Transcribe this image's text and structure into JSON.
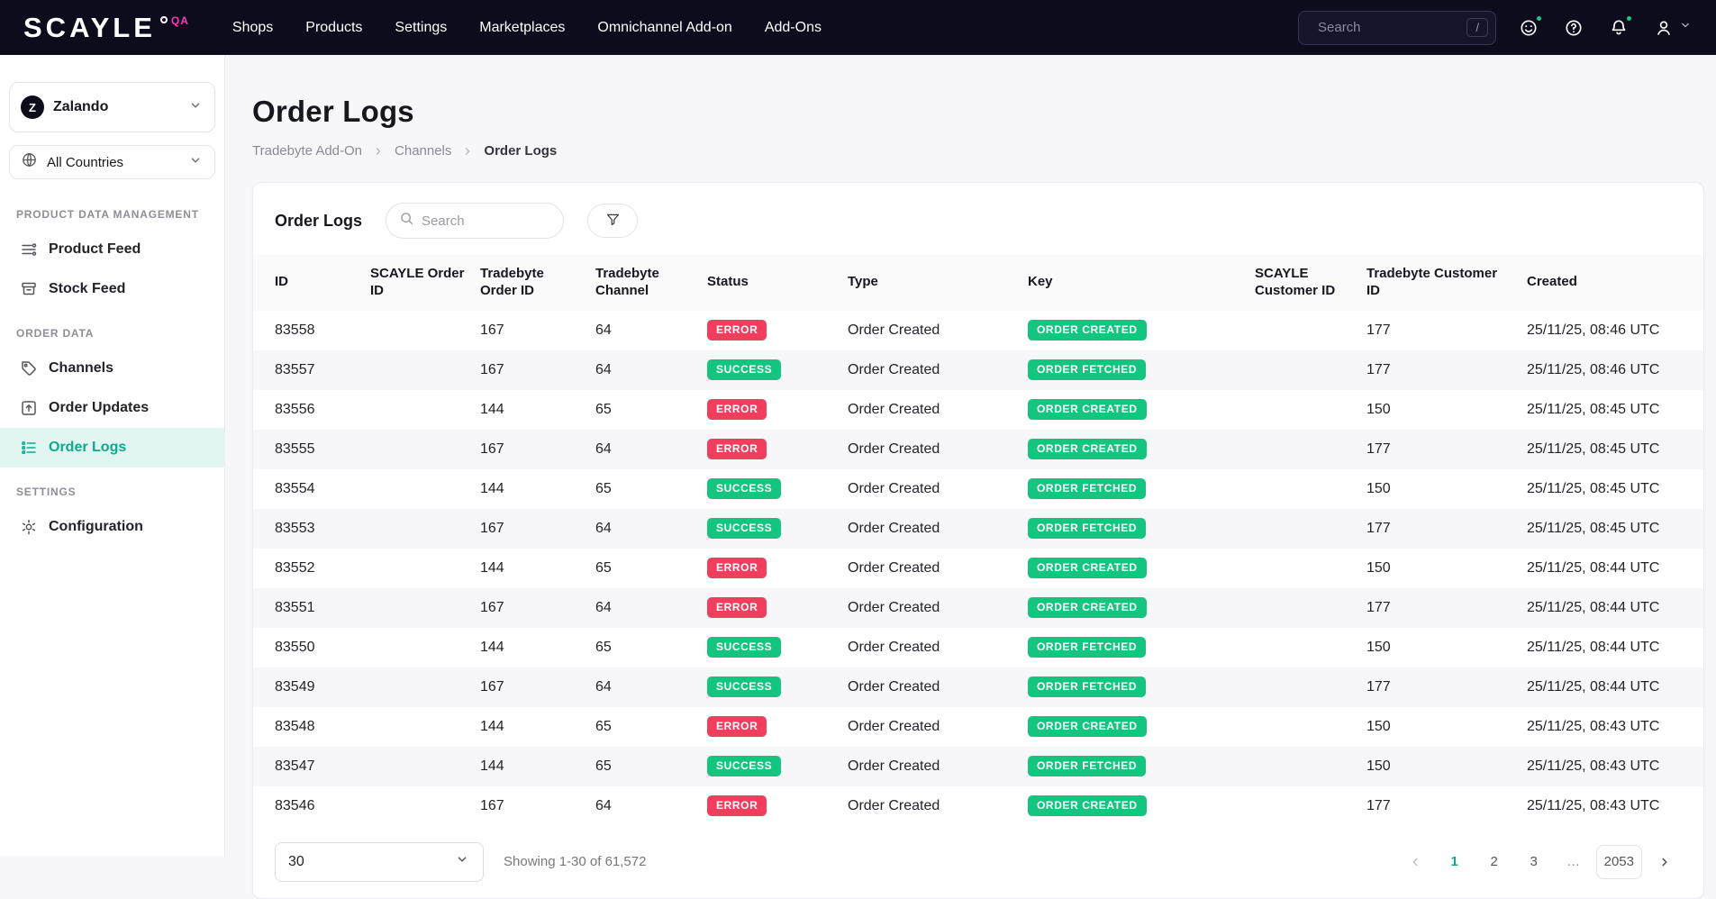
{
  "topbar": {
    "logo": "SCAYLE",
    "env": "QA",
    "nav": [
      "Shops",
      "Products",
      "Settings",
      "Marketplaces",
      "Omnichannel Add-on",
      "Add-Ons"
    ],
    "search": {
      "placeholder": "Search",
      "shortcut": "/"
    }
  },
  "sidebar": {
    "shop_selector": {
      "initial": "Z",
      "name": "Zalando"
    },
    "country_selector": {
      "label": "All Countries"
    },
    "sections": [
      {
        "title": "PRODUCT DATA MANAGEMENT",
        "items": [
          {
            "label": "Product Feed",
            "icon": "product-feed-icon",
            "active": false
          },
          {
            "label": "Stock Feed",
            "icon": "stock-feed-icon",
            "active": false
          }
        ]
      },
      {
        "title": "ORDER DATA",
        "items": [
          {
            "label": "Channels",
            "icon": "channels-icon",
            "active": false
          },
          {
            "label": "Order Updates",
            "icon": "order-updates-icon",
            "active": false
          },
          {
            "label": "Order Logs",
            "icon": "order-logs-icon",
            "active": true
          }
        ]
      },
      {
        "title": "SETTINGS",
        "items": [
          {
            "label": "Configuration",
            "icon": "configuration-icon",
            "active": false
          }
        ]
      }
    ]
  },
  "page": {
    "title": "Order Logs",
    "breadcrumb": [
      "Tradebyte Add-On",
      "Channels",
      "Order Logs"
    ]
  },
  "card": {
    "title": "Order Logs",
    "search_placeholder": "Search",
    "columns": [
      "ID",
      "SCAYLE Order ID",
      "Tradebyte Order ID",
      "Tradebyte Channel",
      "Status",
      "Type",
      "Key",
      "SCAYLE Customer ID",
      "Tradebyte Customer ID",
      "Created"
    ],
    "rows": [
      [
        "83558",
        "",
        "167",
        "64",
        "ERROR",
        "Order Created",
        "ORDER CREATED",
        "",
        "177",
        "25/11/25, 08:46 UTC"
      ],
      [
        "83557",
        "",
        "167",
        "64",
        "SUCCESS",
        "Order Created",
        "ORDER FETCHED",
        "",
        "177",
        "25/11/25, 08:46 UTC"
      ],
      [
        "83556",
        "",
        "144",
        "65",
        "ERROR",
        "Order Created",
        "ORDER CREATED",
        "",
        "150",
        "25/11/25, 08:45 UTC"
      ],
      [
        "83555",
        "",
        "167",
        "64",
        "ERROR",
        "Order Created",
        "ORDER CREATED",
        "",
        "177",
        "25/11/25, 08:45 UTC"
      ],
      [
        "83554",
        "",
        "144",
        "65",
        "SUCCESS",
        "Order Created",
        "ORDER FETCHED",
        "",
        "150",
        "25/11/25, 08:45 UTC"
      ],
      [
        "83553",
        "",
        "167",
        "64",
        "SUCCESS",
        "Order Created",
        "ORDER FETCHED",
        "",
        "177",
        "25/11/25, 08:45 UTC"
      ],
      [
        "83552",
        "",
        "144",
        "65",
        "ERROR",
        "Order Created",
        "ORDER CREATED",
        "",
        "150",
        "25/11/25, 08:44 UTC"
      ],
      [
        "83551",
        "",
        "167",
        "64",
        "ERROR",
        "Order Created",
        "ORDER CREATED",
        "",
        "177",
        "25/11/25, 08:44 UTC"
      ],
      [
        "83550",
        "",
        "144",
        "65",
        "SUCCESS",
        "Order Created",
        "ORDER FETCHED",
        "",
        "150",
        "25/11/25, 08:44 UTC"
      ],
      [
        "83549",
        "",
        "167",
        "64",
        "SUCCESS",
        "Order Created",
        "ORDER FETCHED",
        "",
        "177",
        "25/11/25, 08:44 UTC"
      ],
      [
        "83548",
        "",
        "144",
        "65",
        "ERROR",
        "Order Created",
        "ORDER CREATED",
        "",
        "150",
        "25/11/25, 08:43 UTC"
      ],
      [
        "83547",
        "",
        "144",
        "65",
        "SUCCESS",
        "Order Created",
        "ORDER FETCHED",
        "",
        "150",
        "25/11/25, 08:43 UTC"
      ],
      [
        "83546",
        "",
        "167",
        "64",
        "ERROR",
        "Order Created",
        "ORDER CREATED",
        "",
        "177",
        "25/11/25, 08:43 UTC"
      ]
    ]
  },
  "footer": {
    "page_size": "30",
    "showing": "Showing 1-30 of 61,572",
    "pages": [
      {
        "label": "1",
        "active": true,
        "boxed": false
      },
      {
        "label": "2",
        "active": false,
        "boxed": false
      },
      {
        "label": "3",
        "active": false,
        "boxed": false
      },
      {
        "label": "…",
        "active": false,
        "boxed": false
      },
      {
        "label": "2053",
        "active": false,
        "boxed": true
      }
    ]
  },
  "colors": {
    "accent_teal": "#0caa8f",
    "badge_green": "#13c57e",
    "badge_red": "#f23e5e",
    "env_pink": "#f43ab8",
    "topbar_bg": "#0c0c1d"
  }
}
